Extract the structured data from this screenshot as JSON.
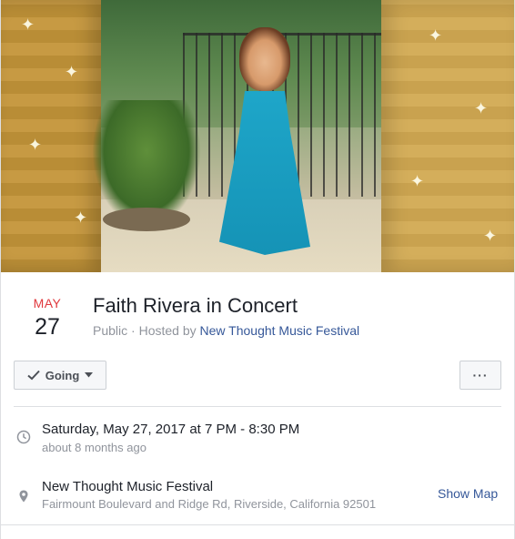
{
  "event": {
    "month": "MAY",
    "day": "27",
    "title": "Faith Rivera in Concert",
    "privacy": "Public",
    "hosted_by_prefix": " · Hosted by ",
    "host": "New Thought Music Festival"
  },
  "actions": {
    "going_label": "Going",
    "more_label": "···"
  },
  "time": {
    "main": "Saturday, May 27, 2017 at 7 PM - 8:30 PM",
    "relative": "about 8 months ago"
  },
  "location": {
    "name": "New Thought Music Festival",
    "address": "Fairmount Boulevard and Ridge Rd, Riverside, California 92501",
    "show_map_label": "Show Map"
  },
  "colors": {
    "month": "#e0393e",
    "link": "#365899",
    "muted": "#90949c"
  },
  "icons": [
    "check-icon",
    "caret-down-icon",
    "clock-icon",
    "map-pin-icon"
  ]
}
